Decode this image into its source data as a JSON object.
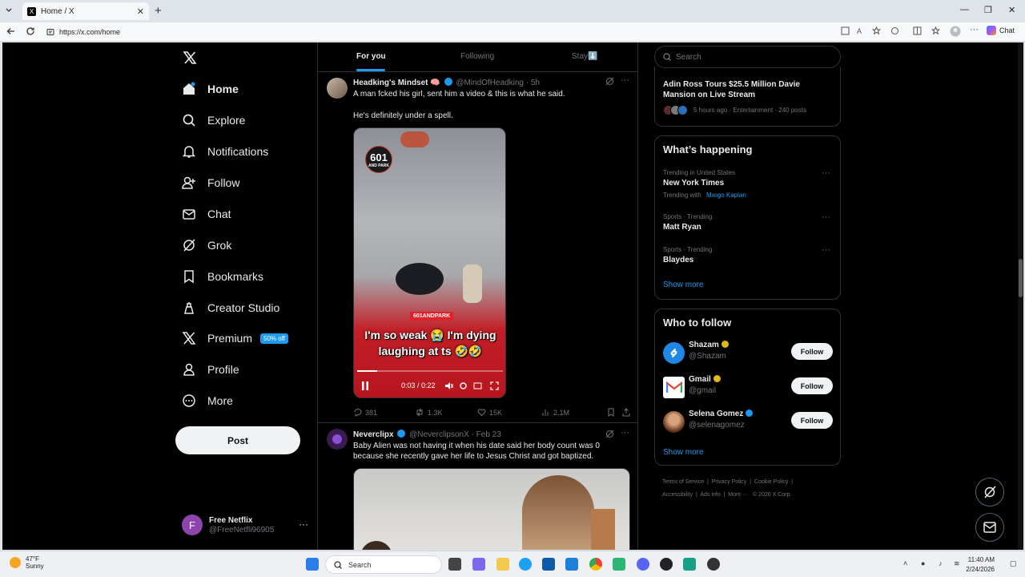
{
  "browser": {
    "tab_title": "Home / X",
    "url": "https://x.com/home",
    "chat_label": "Chat"
  },
  "nav": {
    "logo": "X",
    "items": [
      {
        "label": "Home",
        "icon": "home-icon"
      },
      {
        "label": "Explore",
        "icon": "search-icon"
      },
      {
        "label": "Notifications",
        "icon": "bell-icon"
      },
      {
        "label": "Follow",
        "icon": "follow-icon"
      },
      {
        "label": "Chat",
        "icon": "mail-icon"
      },
      {
        "label": "Grok",
        "icon": "grok-icon"
      },
      {
        "label": "Bookmarks",
        "icon": "bookmark-icon"
      },
      {
        "label": "Creator Studio",
        "icon": "creator-icon"
      },
      {
        "label": "Premium",
        "icon": "x-icon"
      },
      {
        "label": "Profile",
        "icon": "person-icon"
      },
      {
        "label": "More",
        "icon": "more-circle-icon"
      }
    ],
    "premium_badge": "50% off",
    "post_label": "Post",
    "account": {
      "initial": "F",
      "name": "Free Netflix",
      "handle": "@FreeNetfli96905",
      "more": "···"
    }
  },
  "feed": {
    "tabs": [
      "For you",
      "Following",
      "Stay⬇️"
    ],
    "tweets": [
      {
        "name": "Headking's Mindset 🧠",
        "handle": "@MindOfHeadking",
        "time": "· 5h",
        "text1": "A man fcked his girl, sent him a video & this is what he said.",
        "text2": "He's definitely under a spell.",
        "video": {
          "watermark": "601",
          "watermark_sub": "AND PARK",
          "caption_tag": "601ANDPARK",
          "caption_line1": "I'm so weak 😭 I'm dying",
          "caption_line2": "laughing at ts 🤣🤣",
          "time": "0:03 / 0:22",
          "progress": 0.14
        },
        "stats": {
          "replies": "381",
          "reposts": "1.3K",
          "likes": "15K",
          "views": "2.1M"
        }
      },
      {
        "name": "Neverclipx",
        "handle": "@NeverclipsonX",
        "time": "· Feb 23",
        "text1": "Baby Alien was not having it when his date said her body count was 0 because she recently gave her life to Jesus Christ and got baptized."
      }
    ]
  },
  "right": {
    "search_placeholder": "Search",
    "top_story": {
      "title": "Adin Ross Tours $25.5 Million Davie Mansion on Live Stream",
      "meta": "5 hours ago · Entertainment · 240 posts"
    },
    "happening": {
      "title": "What’s happening",
      "trends": [
        {
          "meta": "Trending in United States",
          "name": "New York Times",
          "with_label": "Trending with",
          "with": "Margo Kaplan"
        },
        {
          "meta": "Sports · Trending",
          "name": "Matt Ryan"
        },
        {
          "meta": "Sports · Trending",
          "name": "Blaydes"
        }
      ],
      "show_more": "Show more"
    },
    "who_to_follow": {
      "title": "Who to follow",
      "accounts": [
        {
          "name": "Shazam",
          "handle": "@Shazam",
          "button": "Follow"
        },
        {
          "name": "Gmail",
          "handle": "@gmail",
          "button": "Follow"
        },
        {
          "name": "Selena Gomez",
          "handle": "@selenagomez",
          "button": "Follow"
        }
      ],
      "show_more": "Show more"
    },
    "footer": {
      "line1": [
        "Terms of Service",
        "Privacy Policy",
        "Cookie Policy"
      ],
      "line2": [
        "Accessibility",
        "Ads info",
        "More ···",
        "© 2026 X Corp."
      ]
    }
  },
  "taskbar": {
    "temp": "47°F",
    "condition": "Sunny",
    "search": "Search",
    "time": "11:40 AM",
    "date": "2/24/2026"
  },
  "colors": {
    "accent": "#1d9bf0",
    "background": "#000000",
    "border": "#2f3336",
    "muted": "#71767b"
  }
}
